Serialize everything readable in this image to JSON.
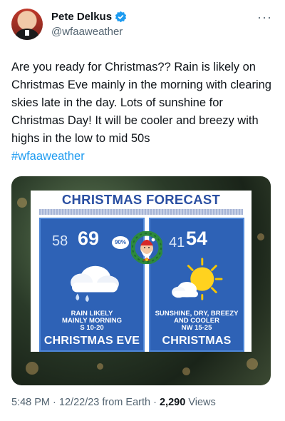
{
  "author": {
    "name": "Pete Delkus",
    "handle": "@wfaaweather"
  },
  "tweet": {
    "text": "Are you ready for Christmas?? Rain is likely on Christmas Eve mainly in the morning with clearing skies late in the day. Lots of sunshine for Christmas Day! It will be cooler and breezy with highs in the low to mid 50s",
    "hashtag": "#wfaaweather"
  },
  "forecast": {
    "title": "CHRISTMAS FORECAST",
    "eve": {
      "low": "58",
      "high": "69",
      "chance": "90%",
      "line1": "RAIN LIKELY",
      "line2": "MAINLY MORNING",
      "line3": "S 10-20",
      "day": "CHRISTMAS EVE",
      "icon": "rain-cloud-icon"
    },
    "christmas": {
      "low": "41",
      "high": "54",
      "line1": "SUNSHINE, DRY, BREEZY",
      "line2": "AND COOLER",
      "line3": "NW 15-25",
      "day": "CHRISTMAS",
      "icon": "sun-cloud-icon"
    }
  },
  "meta": {
    "time": "5:48 PM",
    "date": "12/22/23",
    "source": "from Earth",
    "views_count": "2,290",
    "views_label": "Views"
  },
  "colors": {
    "link": "#1d9bf0",
    "verified": "#1d9bf0",
    "panel": "#2e62b6",
    "title": "#2a4fa2"
  }
}
